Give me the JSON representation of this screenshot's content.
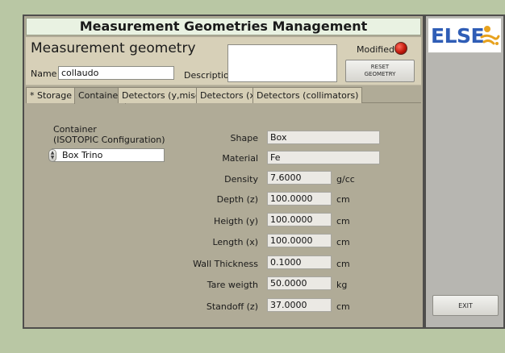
{
  "window": {
    "title": "Measurement Geometries Management"
  },
  "geometry": {
    "section_title": "Measurement geometry",
    "name_label": "Name",
    "name_value": "collaudo",
    "description_label": "Description",
    "description_value": "",
    "modified_label": "Modified",
    "modified_color": "#c21a0c",
    "reset_button_line1": "RESET",
    "reset_button_line2": "GEOMETRY"
  },
  "tabs": [
    {
      "label": "* Storage *",
      "active": false
    },
    {
      "label": "Container",
      "active": true
    },
    {
      "label": "Detectors (y,misc.)",
      "active": false
    },
    {
      "label": "Detectors (x)",
      "active": false
    },
    {
      "label": "Detectors (collimators)",
      "active": false
    }
  ],
  "container": {
    "label_line1": "Container",
    "label_line2": "(ISOTOPIC Configuration)",
    "selected": "Box Trino",
    "properties": [
      {
        "label": "Shape",
        "value": "Box",
        "unit": ""
      },
      {
        "label": "Material",
        "value": "Fe",
        "unit": ""
      },
      {
        "label": "Density",
        "value": "7.6000",
        "unit": "g/cc"
      },
      {
        "label": "Depth (z)",
        "value": "100.0000",
        "unit": "cm"
      },
      {
        "label": "Heigth (y)",
        "value": "100.0000",
        "unit": "cm"
      },
      {
        "label": "Length (x)",
        "value": "100.0000",
        "unit": "cm"
      },
      {
        "label": "Wall Thickness",
        "value": "0.1000",
        "unit": "cm"
      },
      {
        "label": "Tare weigth",
        "value": "50.0000",
        "unit": "kg"
      },
      {
        "label": "Standoff (z)",
        "value": "37.0000",
        "unit": "cm"
      }
    ]
  },
  "side": {
    "logo_text": "ELSE",
    "exit_label": "EXIT"
  },
  "colors": {
    "background": "#b9c7a4",
    "panel": "#b0ab97",
    "logo_blue": "#2f5db6",
    "logo_orange": "#e7a21f"
  }
}
